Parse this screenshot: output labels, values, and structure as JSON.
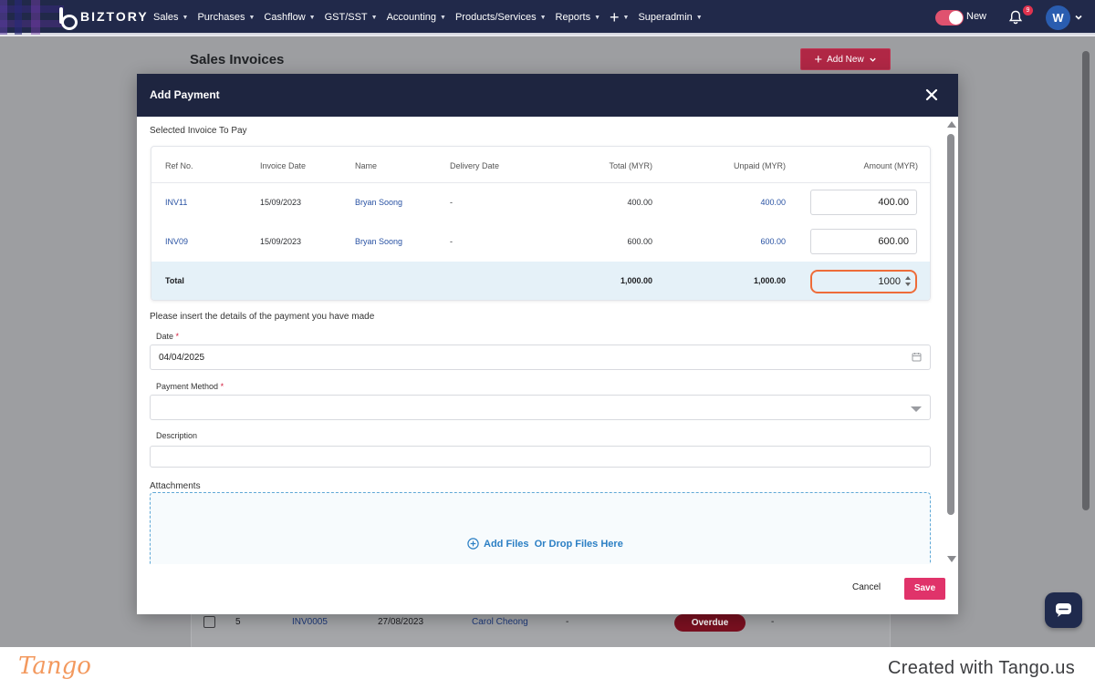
{
  "brand": {
    "name": "BIZTORY"
  },
  "nav": {
    "items": [
      {
        "label": "Sales",
        "caret": true
      },
      {
        "label": "Purchases",
        "caret": true
      },
      {
        "label": "Cashflow",
        "caret": true
      },
      {
        "label": "GST/SST",
        "caret": true
      },
      {
        "label": "Accounting",
        "caret": true
      },
      {
        "label": "Products/Services",
        "caret": true
      },
      {
        "label": "Reports",
        "caret": true
      },
      {
        "label": "+",
        "caret": true
      },
      {
        "label": "Superadmin",
        "caret": true
      }
    ],
    "toggle_label": "New",
    "notification_count": "9",
    "avatar_initial": "W"
  },
  "page": {
    "title": "Sales Invoices",
    "add_new_label": "Add New",
    "background_row": {
      "index": "5",
      "ref": "INV0005",
      "date": "27/08/2023",
      "name": "Carol Cheong",
      "delivery": "-",
      "status": "Overdue",
      "extra": "-"
    }
  },
  "modal": {
    "title": "Add Payment",
    "selected_label": "Selected Invoice To Pay",
    "columns": [
      "Ref No.",
      "Invoice Date",
      "Name",
      "Delivery Date",
      "Total (MYR)",
      "Unpaid (MYR)",
      "Amount (MYR)"
    ],
    "rows": [
      {
        "ref": "INV11",
        "date": "15/09/2023",
        "name": "Bryan Soong",
        "delivery": "-",
        "total": "400.00",
        "unpaid": "400.00",
        "amount": "400.00"
      },
      {
        "ref": "INV09",
        "date": "15/09/2023",
        "name": "Bryan Soong",
        "delivery": "-",
        "total": "600.00",
        "unpaid": "600.00",
        "amount": "600.00"
      }
    ],
    "total_row": {
      "label": "Total",
      "total": "1,000.00",
      "unpaid": "1,000.00",
      "amount": "1000"
    },
    "details_label": "Please insert the details of the payment you have made",
    "date_label": "Date",
    "date_value": "04/04/2025",
    "payment_method_label": "Payment Method",
    "payment_method_value": "",
    "description_label": "Description",
    "description_value": "",
    "required_mark": "*",
    "attachments_label": "Attachments",
    "dropzone_text": "Add Files  Or Drop Files Here",
    "cancel_label": "Cancel",
    "save_label": "Save"
  },
  "footer": {
    "logo": "Tango",
    "credit": "Created with Tango.us"
  },
  "colors": {
    "nav_bg": "#21294a",
    "modal_header_bg": "#1e2540",
    "save_button": "#e0336a",
    "focus_ring": "#ee6c39",
    "link": "#2952a3",
    "overdue_badge": "#7a1020"
  },
  "icons": [
    "biztory-logo-icon",
    "bell-icon",
    "chevron-down-icon",
    "close-icon",
    "calendar-icon",
    "plus-circle-icon",
    "chat-icon",
    "spinner-icon"
  ]
}
